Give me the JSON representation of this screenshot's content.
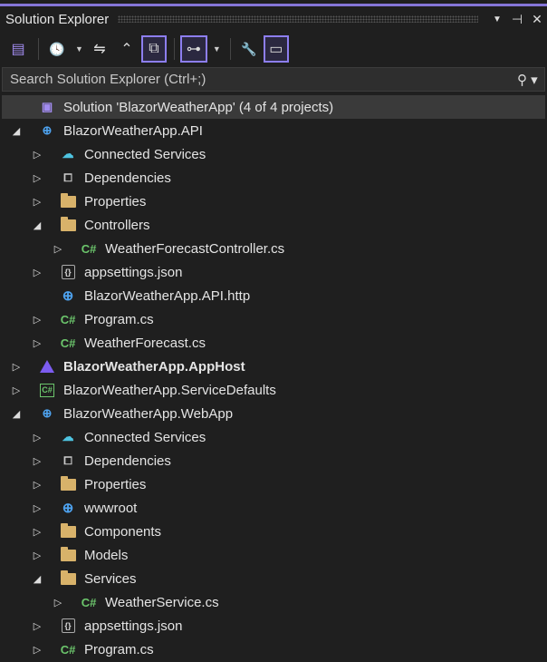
{
  "panel": {
    "title": "Solution Explorer",
    "menu_icon": "▼",
    "pin_icon": "⊣",
    "close_icon": "✕"
  },
  "toolbar": {
    "items": [
      {
        "name": "switch-views-button",
        "glyph": "▤"
      },
      {
        "name": "pending-changes-filter-button",
        "glyph": "🕓"
      },
      {
        "name": "sync-with-document-button",
        "glyph": "⇋"
      },
      {
        "name": "collapse-all-button",
        "glyph": "⌃"
      },
      {
        "name": "show-all-files-button",
        "glyph": "⧉"
      },
      {
        "name": "view-toggle-button",
        "glyph": "⊶"
      },
      {
        "name": "properties-button",
        "glyph": "🔧"
      },
      {
        "name": "preview-selected-button",
        "glyph": "▭"
      }
    ]
  },
  "search": {
    "placeholder": "Search Solution Explorer (Ctrl+;)"
  },
  "tree": [
    {
      "label": "Solution 'BlazorWeatherApp' (4 of 4 projects)",
      "level": 0,
      "exp": "none",
      "icon": "solution",
      "selected": true
    },
    {
      "label": "BlazorWeatherApp.API",
      "level": 0,
      "exp": "expanded",
      "icon": "web-project"
    },
    {
      "label": "Connected Services",
      "level": 1,
      "exp": "collapsed",
      "icon": "cloud"
    },
    {
      "label": "Dependencies",
      "level": 1,
      "exp": "collapsed",
      "icon": "dependencies"
    },
    {
      "label": "Properties",
      "level": 1,
      "exp": "collapsed",
      "icon": "properties-folder"
    },
    {
      "label": "Controllers",
      "level": 1,
      "exp": "expanded",
      "icon": "folder"
    },
    {
      "label": "WeatherForecastController.cs",
      "level": 2,
      "exp": "collapsed",
      "icon": "csharp"
    },
    {
      "label": "appsettings.json",
      "level": 1,
      "exp": "collapsed",
      "icon": "json"
    },
    {
      "label": "BlazorWeatherApp.API.http",
      "level": 1,
      "exp": "none",
      "icon": "http"
    },
    {
      "label": "Program.cs",
      "level": 1,
      "exp": "collapsed",
      "icon": "csharp"
    },
    {
      "label": "WeatherForecast.cs",
      "level": 1,
      "exp": "collapsed",
      "icon": "csharp"
    },
    {
      "label": "BlazorWeatherApp.AppHost",
      "level": 0,
      "exp": "collapsed",
      "icon": "apphost",
      "bold": true
    },
    {
      "label": "BlazorWeatherApp.ServiceDefaults",
      "level": 0,
      "exp": "collapsed",
      "icon": "csproj"
    },
    {
      "label": "BlazorWeatherApp.WebApp",
      "level": 0,
      "exp": "expanded",
      "icon": "web-project"
    },
    {
      "label": "Connected Services",
      "level": 1,
      "exp": "collapsed",
      "icon": "cloud"
    },
    {
      "label": "Dependencies",
      "level": 1,
      "exp": "collapsed",
      "icon": "dependencies"
    },
    {
      "label": "Properties",
      "level": 1,
      "exp": "collapsed",
      "icon": "properties-folder"
    },
    {
      "label": "wwwroot",
      "level": 1,
      "exp": "collapsed",
      "icon": "globe"
    },
    {
      "label": "Components",
      "level": 1,
      "exp": "collapsed",
      "icon": "folder"
    },
    {
      "label": "Models",
      "level": 1,
      "exp": "collapsed",
      "icon": "folder"
    },
    {
      "label": "Services",
      "level": 1,
      "exp": "expanded",
      "icon": "folder"
    },
    {
      "label": "WeatherService.cs",
      "level": 2,
      "exp": "collapsed",
      "icon": "csharp"
    },
    {
      "label": "appsettings.json",
      "level": 1,
      "exp": "collapsed",
      "icon": "json"
    },
    {
      "label": "Program.cs",
      "level": 1,
      "exp": "collapsed",
      "icon": "csharp"
    }
  ]
}
